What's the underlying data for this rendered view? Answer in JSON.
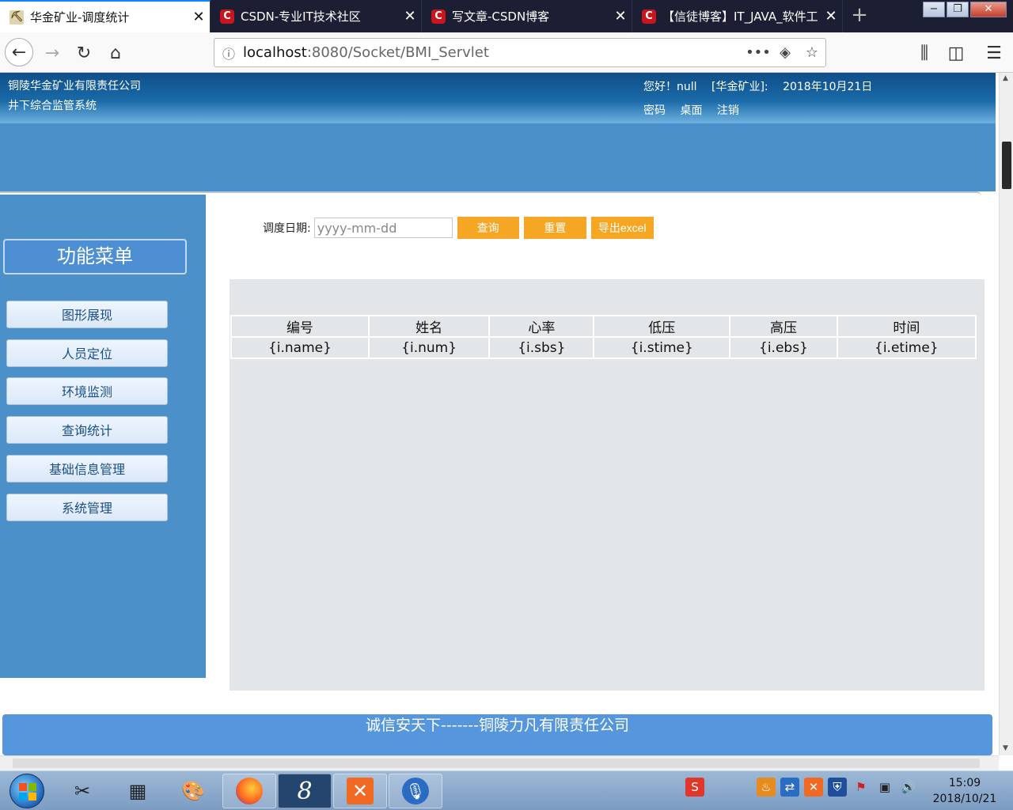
{
  "browser": {
    "tabs": [
      {
        "title": "华金矿业-调度统计",
        "active": true,
        "icon": "mine-icon"
      },
      {
        "title": "CSDN-专业IT技术社区",
        "active": false,
        "icon": "csdn-icon"
      },
      {
        "title": "写文章-CSDN博客",
        "active": false,
        "icon": "csdn-icon"
      },
      {
        "title": "【信徒博客】IT_JAVA_软件工",
        "active": false,
        "icon": "csdn-icon"
      }
    ],
    "url": {
      "host": "localhost",
      "path": ":8080/Socket/BMI_Servlet"
    },
    "window_buttons": [
      "−",
      "❐",
      "✕"
    ]
  },
  "header": {
    "company_line1": "铜陵华金矿业有限责任公司",
    "company_line2": "井下综合监管系统",
    "greeting": "您好！null",
    "org": "[华金矿业]:",
    "date": "2018年10月21日",
    "links": [
      "密码",
      "桌面",
      "注销"
    ]
  },
  "sidebar": {
    "title": "功能菜单",
    "items": [
      "图形展现",
      "人员定位",
      "环境监测",
      "查询统计",
      "基础信息管理",
      "系统管理"
    ]
  },
  "search": {
    "label": "调度日期:",
    "placeholder": "yyyy-mm-dd",
    "query_button": "查询",
    "reset_button": "重置",
    "export_button": "导出excel"
  },
  "table": {
    "headers": [
      "编号",
      "姓名",
      "心率",
      "低压",
      "高压",
      "时间"
    ],
    "rows": [
      [
        "{i.name}",
        "{i.num}",
        "{i.sbs}",
        "{i.stime}",
        "{i.ebs}",
        "{i.etime}"
      ]
    ]
  },
  "footer": {
    "text": "诚信安天下-------铜陵力凡有限责任公司"
  },
  "taskbar": {
    "time": "15:09",
    "date": "2018/10/21"
  }
}
